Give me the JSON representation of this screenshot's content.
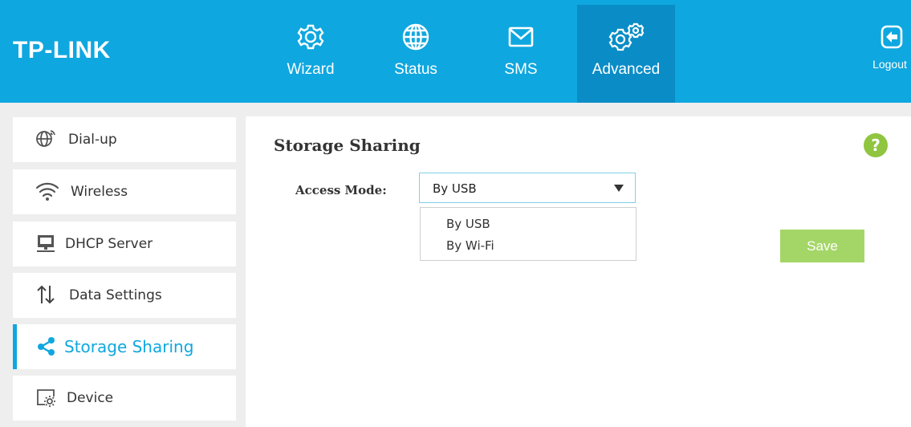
{
  "header": {
    "logo": "TP-LINK",
    "nav": [
      {
        "label": "Wizard",
        "icon": "gear-icon"
      },
      {
        "label": "Status",
        "icon": "globe-icon"
      },
      {
        "label": "SMS",
        "icon": "envelope-icon"
      },
      {
        "label": "Advanced",
        "icon": "gears-icon",
        "active": true
      }
    ],
    "logout": {
      "label": "Logout",
      "icon": "logout-icon"
    }
  },
  "sidebar": {
    "items": [
      {
        "label": "Dial-up",
        "icon": "globe-signal-icon"
      },
      {
        "label": "Wireless",
        "icon": "wifi-icon"
      },
      {
        "label": "DHCP Server",
        "icon": "network-folder-icon"
      },
      {
        "label": "Data Settings",
        "icon": "up-down-arrows-icon"
      },
      {
        "label": "Storage Sharing",
        "icon": "share-icon",
        "active": true
      },
      {
        "label": "Device",
        "icon": "device-settings-icon"
      }
    ]
  },
  "main": {
    "title": "Storage Sharing",
    "help_label": "?",
    "access_mode": {
      "label": "Access Mode:",
      "selected": "By USB",
      "options": [
        "By USB",
        "By Wi-Fi"
      ]
    },
    "save_label": "Save"
  },
  "colors": {
    "header": "#0fa7df",
    "header_active": "#0a8dc7",
    "accent": "#0fa7df",
    "save_button": "#a4d667",
    "help_icon": "#8fc53f"
  }
}
